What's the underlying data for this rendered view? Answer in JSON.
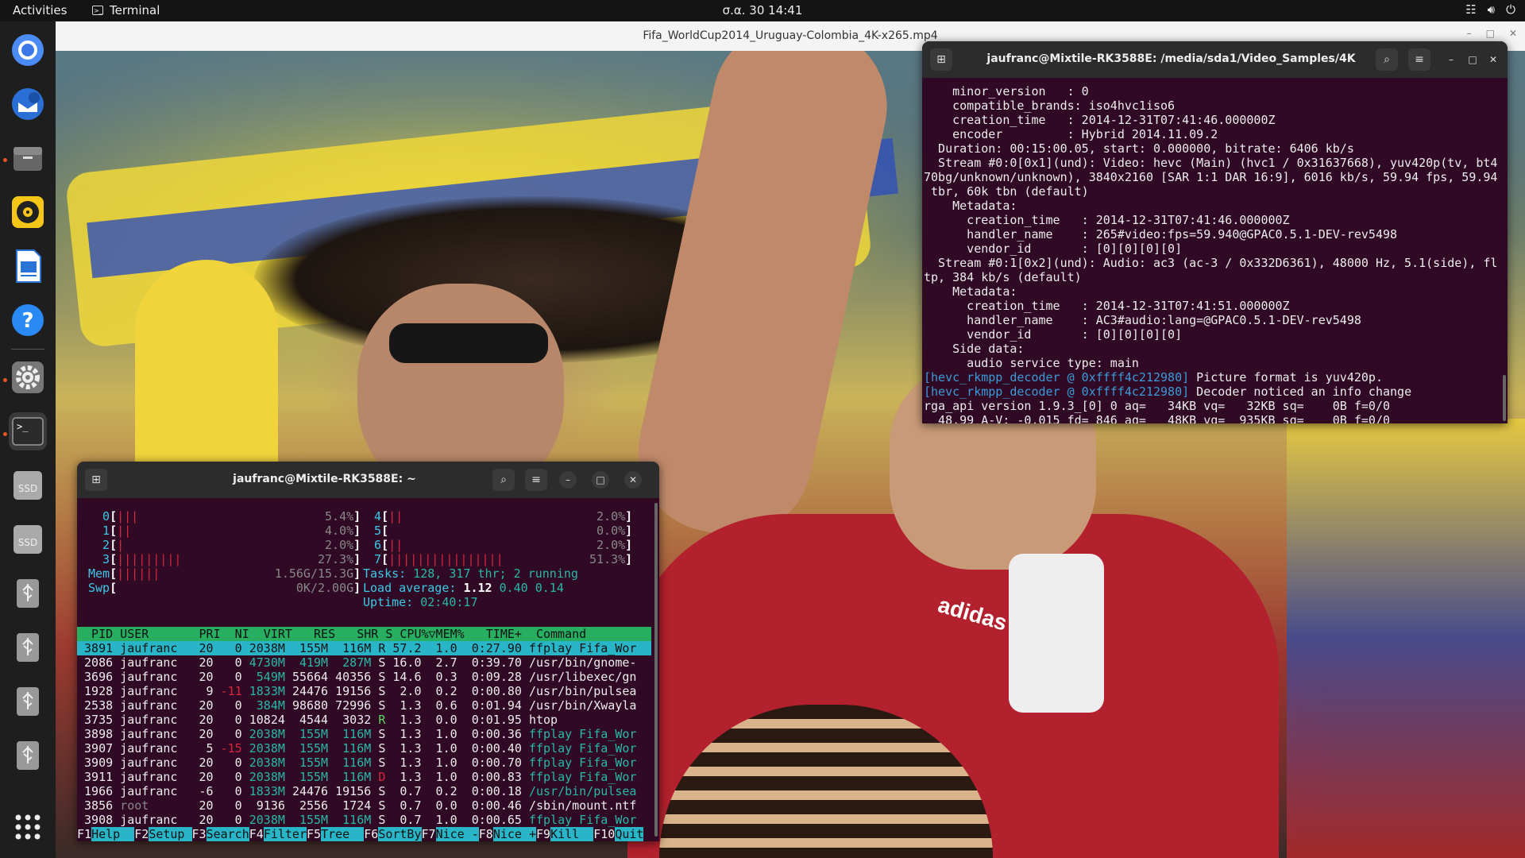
{
  "topbar": {
    "activities": "Activities",
    "app_name": "Terminal",
    "clock": "σ.α. 30  14:41",
    "tray_icons": [
      "network-icon",
      "volume-icon",
      "power-icon"
    ]
  },
  "dock": {
    "items": [
      {
        "name": "chromium",
        "color": "#4a8bf5"
      },
      {
        "name": "thunderbird",
        "color": "#2a6fd6"
      },
      {
        "name": "files",
        "color": "#555"
      },
      {
        "name": "rhythmbox",
        "color": "#f5c518"
      },
      {
        "name": "writer",
        "color": "#2a74d9"
      },
      {
        "name": "help",
        "color": "#2a8af5"
      },
      {
        "name": "settings",
        "color": "#888"
      },
      {
        "name": "terminal",
        "color": "#333"
      },
      {
        "name": "ssd-1",
        "label": "SSD"
      },
      {
        "name": "ssd-2",
        "label": "SSD"
      },
      {
        "name": "usb-1"
      },
      {
        "name": "usb-2"
      },
      {
        "name": "usb-3"
      },
      {
        "name": "usb-4"
      }
    ],
    "apps_grid_icon": "apps-grid-icon"
  },
  "video": {
    "title": "Fifa_WorldCup2014_Uruguay-Colombia_4K-x265.mp4",
    "overlay_text": "adidas"
  },
  "ffplay_terminal": {
    "title": "jaufranc@Mixtile-RK3588E: /media/sda1/Video_Samples/4K",
    "lines": [
      "    minor_version   : 0",
      "    compatible_brands: iso4hvc1iso6",
      "    creation_time   : 2014-12-31T07:41:46.000000Z",
      "    encoder         : Hybrid 2014.11.09.2",
      "  Duration: 00:15:00.05, start: 0.000000, bitrate: 6406 kb/s",
      "  Stream #0:0[0x1](und): Video: hevc (Main) (hvc1 / 0x31637668), yuv420p(tv, bt4",
      "70bg/unknown/unknown), 3840x2160 [SAR 1:1 DAR 16:9], 6016 kb/s, 59.94 fps, 59.94",
      " tbr, 60k tbn (default)",
      "    Metadata:",
      "      creation_time   : 2014-12-31T07:41:46.000000Z",
      "      handler_name    : 265#video:fps=59.940@GPAC0.5.1-DEV-rev5498",
      "      vendor_id       : [0][0][0][0]",
      "  Stream #0:1[0x2](und): Audio: ac3 (ac-3 / 0x332D6361), 48000 Hz, 5.1(side), fl",
      "tp, 384 kb/s (default)",
      "    Metadata:",
      "      creation_time   : 2014-12-31T07:41:51.000000Z",
      "      handler_name    : AC3#audio:lang=@GPAC0.5.1-DEV-rev5498",
      "      vendor_id       : [0][0][0][0]",
      "    Side data:",
      "      audio service type: main"
    ],
    "decoder_lines": [
      {
        "tag": "[hevc_rkmpp_decoder @ 0xffff4c212980]",
        "msg": " Picture format is yuv420p."
      },
      {
        "tag": "[hevc_rkmpp_decoder @ 0xffff4c212980]",
        "msg": " Decoder noticed an info change"
      }
    ],
    "tail_lines": [
      "rga_api version 1.9.3_[0] 0 aq=   34KB vq=   32KB sq=    0B f=0/0",
      "  48.99 A-V: -0.015 fd= 846 aq=   48KB vq=  935KB sq=    0B f=0/0"
    ]
  },
  "htop_terminal": {
    "title": "jaufranc@Mixtile-RK3588E: ~",
    "cpus": [
      {
        "id": "0",
        "bars": "|||",
        "pct": "5.4%"
      },
      {
        "id": "1",
        "bars": "||",
        "pct": "4.0%"
      },
      {
        "id": "2",
        "bars": "|",
        "pct": "2.0%"
      },
      {
        "id": "3",
        "bars": "|||||||||",
        "pct": "27.3%"
      },
      {
        "id": "4",
        "bars": "||",
        "pct": "2.0%"
      },
      {
        "id": "5",
        "bars": "",
        "pct": "0.0%"
      },
      {
        "id": "6",
        "bars": "||",
        "pct": "2.0%"
      },
      {
        "id": "7",
        "bars": "||||||||||||||||",
        "pct": "51.3%"
      }
    ],
    "mem": {
      "label": "Mem",
      "bars": "||||||",
      "value": "1.56G/15.3G"
    },
    "swp": {
      "label": "Swp",
      "bars": "",
      "value": "0K/2.00G"
    },
    "tasks": {
      "label": "Tasks:",
      "value": "128, 317 thr; 2 running"
    },
    "load": {
      "label": "Load average:",
      "v1": "1.12",
      "v2": "0.40",
      "v3": "0.14"
    },
    "uptime": {
      "label": "Uptime:",
      "value": "02:40:17"
    },
    "columns": "  PID USER       PRI  NI  VIRT   RES   SHR S CPU%▽MEM%   TIME+  Command",
    "processes": [
      {
        "pid": "3891",
        "user": "jaufranc",
        "pri": "20",
        "ni": "0",
        "virt": "2038M",
        "res": "155M",
        "shr": "116M",
        "s": "R",
        "cpu": "57.2",
        "mem": "1.0",
        "time": "0:27.90",
        "cmd": "ffplay Fifa_Wor"
      },
      {
        "pid": "2086",
        "user": "jaufranc",
        "pri": "20",
        "ni": "0",
        "virt": "4730M",
        "res": "419M",
        "shr": "287M",
        "s": "S",
        "cpu": "16.0",
        "mem": "2.7",
        "time": "0:39.70",
        "cmd": "/usr/bin/gnome-"
      },
      {
        "pid": "3696",
        "user": "jaufranc",
        "pri": "20",
        "ni": "0",
        "virt": "549M",
        "res": "55664",
        "shr": "40356",
        "s": "S",
        "cpu": "14.6",
        "mem": "0.3",
        "time": "0:09.28",
        "cmd": "/usr/libexec/gn"
      },
      {
        "pid": "1928",
        "user": "jaufranc",
        "pri": "9",
        "ni": "-11",
        "virt": "1833M",
        "res": "24476",
        "shr": "19156",
        "s": "S",
        "cpu": "2.0",
        "mem": "0.2",
        "time": "0:00.80",
        "cmd": "/usr/bin/pulsea"
      },
      {
        "pid": "2538",
        "user": "jaufranc",
        "pri": "20",
        "ni": "0",
        "virt": "384M",
        "res": "98680",
        "shr": "72996",
        "s": "S",
        "cpu": "1.3",
        "mem": "0.6",
        "time": "0:01.94",
        "cmd": "/usr/bin/Xwayla"
      },
      {
        "pid": "3735",
        "user": "jaufranc",
        "pri": "20",
        "ni": "0",
        "virt": "10824",
        "res": "4544",
        "shr": "3032",
        "s": "R",
        "cpu": "1.3",
        "mem": "0.0",
        "time": "0:01.95",
        "cmd": "htop"
      },
      {
        "pid": "3898",
        "user": "jaufranc",
        "pri": "20",
        "ni": "0",
        "virt": "2038M",
        "res": "155M",
        "shr": "116M",
        "s": "S",
        "cpu": "1.3",
        "mem": "1.0",
        "time": "0:00.36",
        "cmd": "ffplay Fifa_Wor"
      },
      {
        "pid": "3907",
        "user": "jaufranc",
        "pri": "5",
        "ni": "-15",
        "virt": "2038M",
        "res": "155M",
        "shr": "116M",
        "s": "S",
        "cpu": "1.3",
        "mem": "1.0",
        "time": "0:00.40",
        "cmd": "ffplay Fifa_Wor"
      },
      {
        "pid": "3909",
        "user": "jaufranc",
        "pri": "20",
        "ni": "0",
        "virt": "2038M",
        "res": "155M",
        "shr": "116M",
        "s": "S",
        "cpu": "1.3",
        "mem": "1.0",
        "time": "0:00.70",
        "cmd": "ffplay Fifa_Wor"
      },
      {
        "pid": "3911",
        "user": "jaufranc",
        "pri": "20",
        "ni": "0",
        "virt": "2038M",
        "res": "155M",
        "shr": "116M",
        "s": "D",
        "cpu": "1.3",
        "mem": "1.0",
        "time": "0:00.83",
        "cmd": "ffplay Fifa_Wor"
      },
      {
        "pid": "1966",
        "user": "jaufranc",
        "pri": "-6",
        "ni": "0",
        "virt": "1833M",
        "res": "24476",
        "shr": "19156",
        "s": "S",
        "cpu": "0.7",
        "mem": "0.2",
        "time": "0:00.18",
        "cmd": "/usr/bin/pulsea"
      },
      {
        "pid": "3856",
        "user": "root",
        "pri": "20",
        "ni": "0",
        "virt": "9136",
        "res": "2556",
        "shr": "1724",
        "s": "S",
        "cpu": "0.7",
        "mem": "0.0",
        "time": "0:00.46",
        "cmd": "/sbin/mount.ntf"
      },
      {
        "pid": "3908",
        "user": "jaufranc",
        "pri": "20",
        "ni": "0",
        "virt": "2038M",
        "res": "155M",
        "shr": "116M",
        "s": "S",
        "cpu": "0.7",
        "mem": "1.0",
        "time": "0:00.65",
        "cmd": "ffplay Fifa_Wor"
      }
    ],
    "fkeys": [
      {
        "key": "F1",
        "label": "Help  "
      },
      {
        "key": "F2",
        "label": "Setup "
      },
      {
        "key": "F3",
        "label": "Search"
      },
      {
        "key": "F4",
        "label": "Filter"
      },
      {
        "key": "F5",
        "label": "Tree  "
      },
      {
        "key": "F6",
        "label": "SortBy"
      },
      {
        "key": "F7",
        "label": "Nice -"
      },
      {
        "key": "F8",
        "label": "Nice +"
      },
      {
        "key": "F9",
        "label": "Kill  "
      },
      {
        "key": "F10",
        "label": "Quit"
      }
    ]
  }
}
